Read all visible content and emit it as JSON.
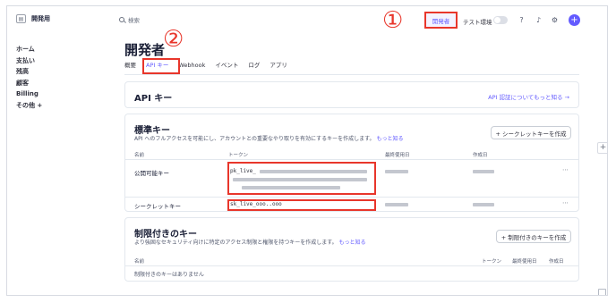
{
  "app": {
    "name": "開発用",
    "icon": "app-box-icon"
  },
  "sidebar": {
    "items": [
      "ホーム",
      "支払い",
      "残高",
      "顧客",
      "Billing",
      "その他 +"
    ]
  },
  "topbar": {
    "search_placeholder": "検索",
    "developer_label": "開発者",
    "test_env_label": "テスト環境",
    "icons": [
      "help-icon",
      "bell-icon",
      "gear-icon",
      "plus-icon"
    ]
  },
  "annotations": {
    "first": "①",
    "second": "②"
  },
  "page": {
    "title": "開発者",
    "tabs": [
      "概要",
      "API キー",
      "Webhook",
      "イベント",
      "ログ",
      "アプリ"
    ],
    "active_tab": "API キー"
  },
  "api_card": {
    "title": "API キー",
    "link": "API 認証についてもっと知る →"
  },
  "standard_card": {
    "title": "標準キー",
    "subtitle": "API へのフルアクセスを可能にし、アカウントとの重要なやり取りを有効にするキーを作成します。",
    "subtitle_link": "もっと知る",
    "create_button": "+ シークレットキーを作成",
    "columns": [
      "名前",
      "トークン",
      "最終使用日",
      "作成日"
    ],
    "rows": [
      {
        "name": "公開可能キー",
        "token": "pk_live_"
      },
      {
        "name": "シークレットキー",
        "token": "sk_live_ooo..ooo"
      }
    ]
  },
  "restricted_card": {
    "title": "制限付きのキー",
    "subtitle": "より強固なセキュリティ向けに特定のアクセス制限と権限を持つキーを作成します。",
    "subtitle_link": "もっと知る",
    "create_button": "+ 制限付きのキーを作成",
    "columns": [
      "名前",
      "トークン",
      "最終使用日",
      "作成日"
    ],
    "empty": "制限付きのキーはありません"
  },
  "colors": {
    "accent": "#635bff",
    "annotation": "#e8362b"
  }
}
